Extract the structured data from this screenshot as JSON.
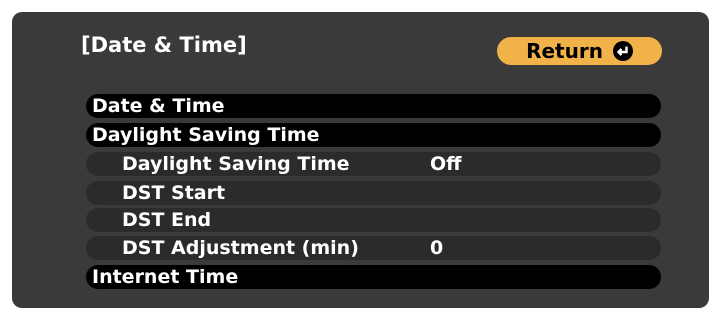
{
  "header": {
    "title": "[Date & Time]",
    "return_label": "Return"
  },
  "icons": {
    "return": "enter-icon"
  },
  "colors": {
    "panel": "#3a3a3a",
    "return_button": "#f2b24a",
    "primary_row": "#000000",
    "sub_row": "#2b2b2b",
    "text": "#ffffff"
  },
  "menu": {
    "items": [
      {
        "label": "Date & Time",
        "value": ""
      },
      {
        "label": "Daylight Saving Time",
        "value": ""
      },
      {
        "label": "Daylight Saving Time",
        "value": "Off"
      },
      {
        "label": "DST Start",
        "value": ""
      },
      {
        "label": "DST End",
        "value": ""
      },
      {
        "label": "DST Adjustment (min)",
        "value": "0"
      },
      {
        "label": "Internet Time",
        "value": ""
      }
    ]
  }
}
